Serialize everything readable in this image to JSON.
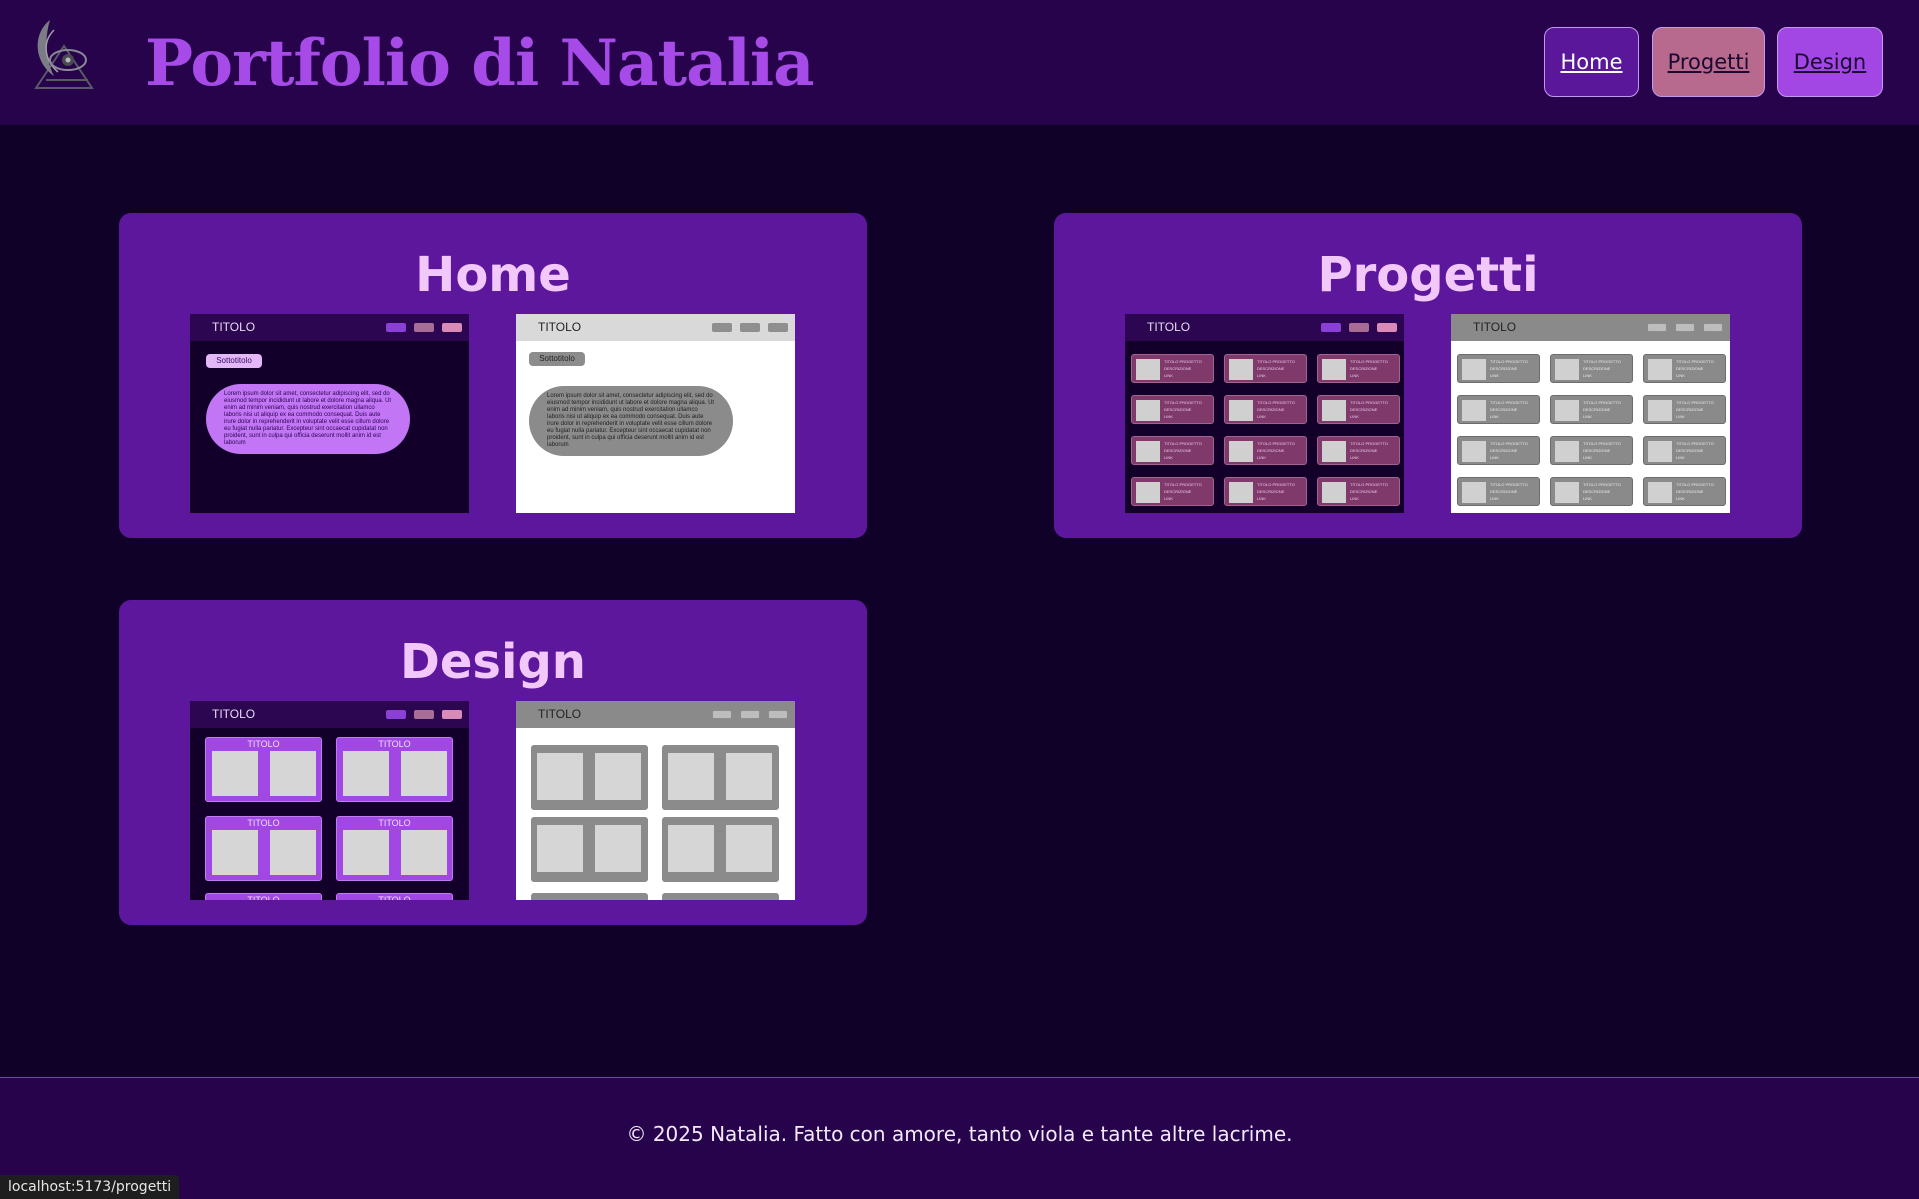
{
  "header": {
    "title": "Portfolio di Natalia",
    "logo_icon": "eye-feather-logo",
    "nav": [
      {
        "label": "Home",
        "color": "#5a179a"
      },
      {
        "label": "Progetti",
        "color": "#b86a8e"
      },
      {
        "label": "Design",
        "color": "#a347e4"
      }
    ]
  },
  "cards": {
    "home": {
      "title": "Home",
      "preview_dark": {
        "bar_title": "TITOLO",
        "tag": "Sottotitolo",
        "text": "Lorem ipsum dolor sit amet, consectetur adipiscing elit, sed do eiusmod tempor incididunt ut labore et dolore magna aliqua. Ut enim ad minim veniam, quis nostrud exercitation ullamco laboris nisi ut aliquip ex ea commodo consequat. Duis aute irure dolor in reprehenderit in voluptate velit esse cillum dolore eu fugiat nulla pariatur. Excepteur sint occaecat cupidatat non proident, sunt in culpa qui officia deserunt mollit anim id est laborum"
      },
      "preview_light": {
        "bar_title": "TITOLO",
        "tag": "Sottotitolo",
        "text": "Lorem ipsum dolor sit amet, consectetur adipiscing elit, sed do eiusmod tempor incididunt ut labore et dolore magna aliqua. Ut enim ad minim veniam, quis nostrud exercitation ullamco laboris nisi ut aliquip ex ea commodo consequat. Duis aute irure dolor in reprehenderit in voluptate velit esse cillum dolore eu fugiat nulla pariatur. Excepteur sint occaecat cupidatat non proident, sunt in culpa qui officia deserunt mollit anim id est laborum"
      }
    },
    "progetti": {
      "title": "Progetti",
      "preview_dark": {
        "bar_title": "TITOLO"
      },
      "preview_light": {
        "bar_title": "TITOLO"
      },
      "item": {
        "line1": "TITOLO PROGETTO",
        "line2": "DESCRIZIONE",
        "line3": "LINK"
      }
    },
    "design": {
      "title": "Design",
      "preview_dark": {
        "bar_title": "TITOLO",
        "cell_title": "TITOLO"
      },
      "preview_light": {
        "bar_title": "TITOLO"
      }
    }
  },
  "footer": {
    "text": "© 2025 Natalia. Fatto con amore, tanto viola e tante altre lacrime."
  },
  "status_bar": {
    "url": "localhost:5173/progetti"
  }
}
